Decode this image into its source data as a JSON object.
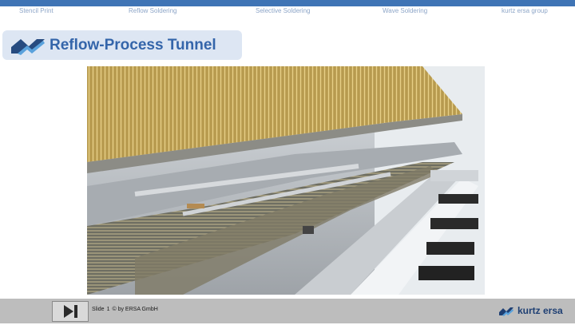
{
  "nav": {
    "items": [
      "Stencil Print",
      "Reflow Soldering",
      "Selective Soldering",
      "Wave Soldering",
      "kurtz ersa group"
    ]
  },
  "header": {
    "title": "Reflow-Process Tunnel"
  },
  "footer": {
    "slide_label": "Slide",
    "slide_number": "1",
    "copyright": "© by ERSA GmbH",
    "brand": "kurtz ersa"
  },
  "colors": {
    "accent": "#3f74b5",
    "title": "#3465aa",
    "title_bg": "#dde6f3",
    "footer_bg": "#bdbdbd"
  },
  "icons": {
    "logo": "ersa-check-logo-icon",
    "play": "next-slide-icon"
  }
}
